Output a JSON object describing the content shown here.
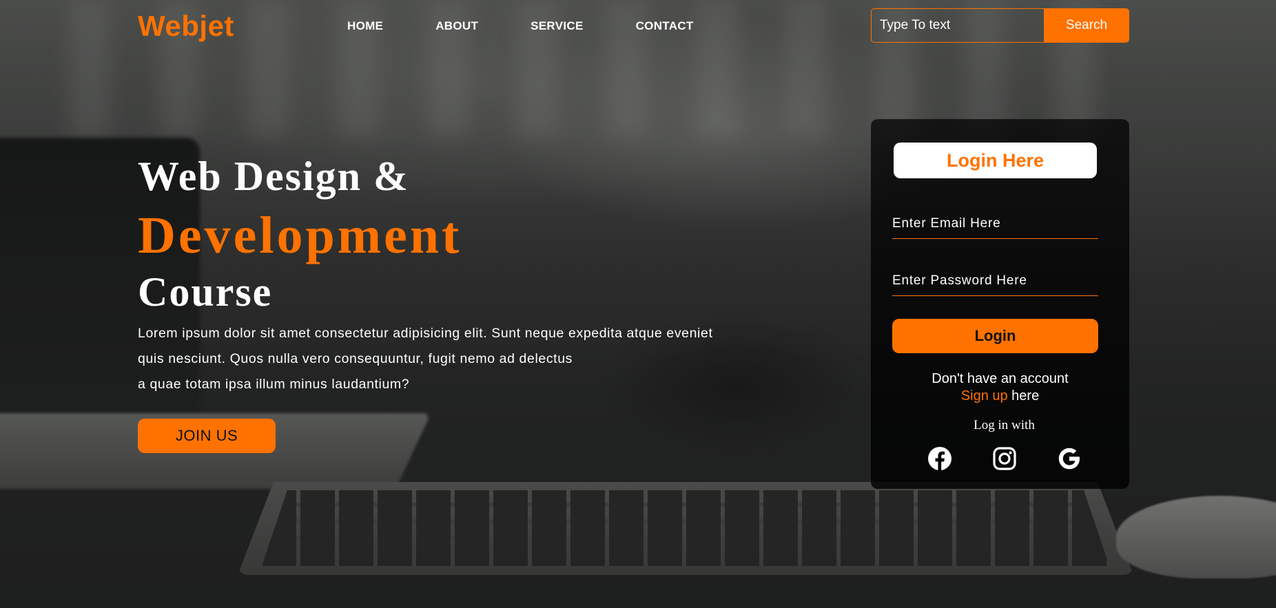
{
  "brand": {
    "logo": "Webjet",
    "accent_color": "#ff7200"
  },
  "nav": {
    "items": [
      {
        "label": "HOME"
      },
      {
        "label": "ABOUT"
      },
      {
        "label": "SERVICE"
      },
      {
        "label": "CONTACT"
      }
    ]
  },
  "search": {
    "placeholder": "Type To text",
    "button_label": "Search"
  },
  "hero": {
    "line1": "Web Design &",
    "line2": "Development",
    "line3": "Course",
    "description": [
      "Lorem ipsum dolor sit amet consectetur adipisicing elit. Sunt neque expedita atque eveniet",
      "quis nesciunt. Quos nulla vero consequuntur, fugit nemo ad delectus",
      "a quae totam ipsa illum minus laudantium?"
    ],
    "cta_label": "JOIN US"
  },
  "login": {
    "title": "Login Here",
    "email_placeholder": "Enter Email Here",
    "password_placeholder": "Enter Password Here",
    "button_label": "Login",
    "no_account_text": "Don't have an account",
    "signup_link": "Sign up",
    "signup_suffix": " here",
    "login_with": "Log in with",
    "socials": [
      {
        "icon": "facebook-icon"
      },
      {
        "icon": "instagram-icon"
      },
      {
        "icon": "google-icon"
      }
    ]
  }
}
